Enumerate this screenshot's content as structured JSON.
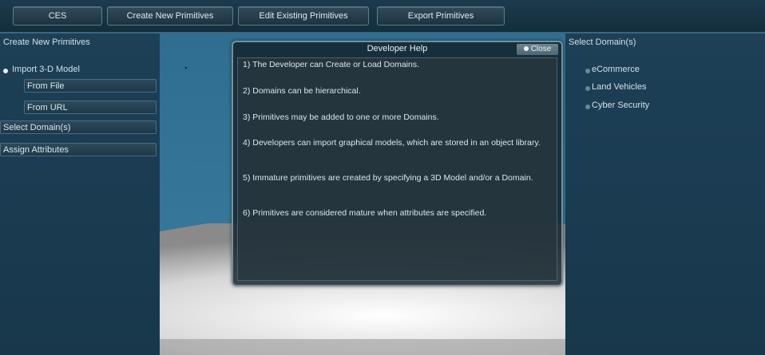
{
  "topbar": {
    "buttons": [
      "CES",
      "Create New Primitives",
      "Edit Existing Primitives",
      "Export Primitives"
    ]
  },
  "left_panel": {
    "title": "Create New Primitives",
    "import_option": "Import 3-D Model",
    "from_file": "From File",
    "from_url": "From URL",
    "select_domains": "Select Domain(s)",
    "assign_attributes": "Assign Attributes"
  },
  "right_panel": {
    "title": "Select Domain(s)",
    "domains": [
      "eCommerce",
      "Land Vehicles",
      "Cyber Security"
    ]
  },
  "dialog": {
    "title": "Developer Help",
    "close_label": "Close",
    "lines": [
      "1) The Developer can Create or Load Domains.",
      "2) Domains can be hierarchical.",
      "3) Primitives may be added to one or more Domains.",
      "4) Developers can import graphical models, which are stored in an object library.",
      "5) Immature primitives are created by specifying a 3D Model and/or a Domain.",
      "6) Primitives are considered mature when attributes are specified."
    ]
  }
}
